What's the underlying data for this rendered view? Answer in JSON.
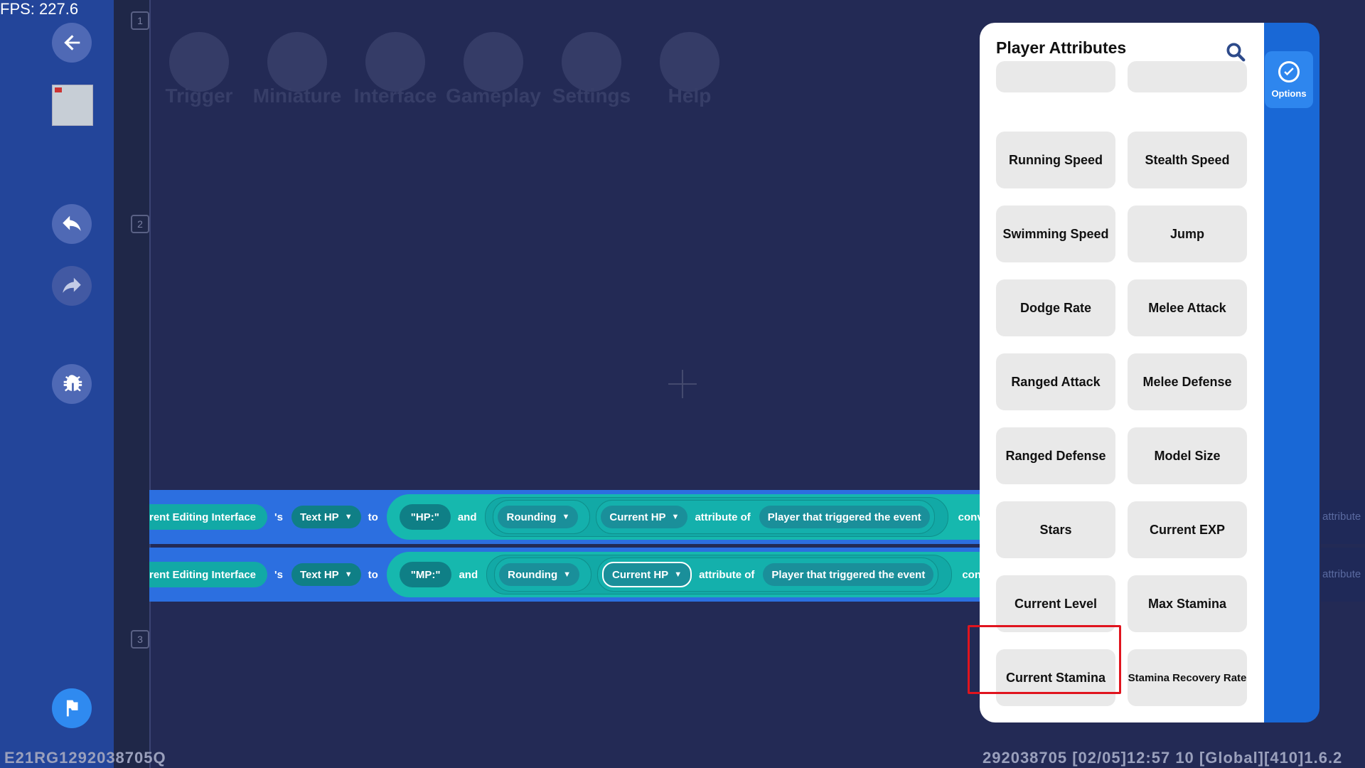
{
  "fps": "FPS: 227.6",
  "top_tabs": [
    "Trigger",
    "Miniature",
    "Interface",
    "Gameplay",
    "Settings",
    "Help"
  ],
  "ruler_marks": [
    "1",
    "2",
    "3"
  ],
  "code_rows": [
    {
      "object": "rent Editing Interface",
      "possessive": "'s",
      "element": "Text HP",
      "to": "to",
      "prefix": "\"HP:\"",
      "and": "and",
      "rounding": "Rounding",
      "attribute": "Current HP",
      "attr_of": "attribute of",
      "target": "Player that triggered the event",
      "converts": "converts to"
    },
    {
      "object": "rent Editing Interface",
      "possessive": "'s",
      "element": "Text HP",
      "to": "to",
      "prefix": "\"MP:\"",
      "and": "and",
      "rounding": "Rounding",
      "attribute": "Current HP",
      "attr_of": "attribute of",
      "target": "Player that triggered the event",
      "converts": "converts t"
    }
  ],
  "ghost_right": [
    "attribute",
    "attribute"
  ],
  "panel": {
    "title": "Player Attributes",
    "options_label": "Options",
    "attributes": [
      "Running Speed",
      "Stealth Speed",
      "Swimming Speed",
      "Jump",
      "Dodge Rate",
      "Melee Attack",
      "Ranged Attack",
      "Melee Defense",
      "Ranged Defense",
      "Model Size",
      "Stars",
      "Current EXP",
      "Current Level",
      "Max Stamina",
      "Current Stamina",
      "Stamina Recovery Rate"
    ],
    "highlighted": "Current Stamina"
  },
  "status_left": "E21RG1292038705Q",
  "status_right": "292038705    [02/05]12:57 10  [Global][410]1.6.2"
}
